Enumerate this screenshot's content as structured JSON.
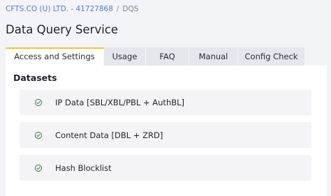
{
  "breadcrumb": {
    "org": "CFTS.CO (U) LTD. - 41727868",
    "separator": "/",
    "current": "DQS"
  },
  "page": {
    "title": "Data Query Service"
  },
  "tabs": [
    {
      "label": "Access and Settings",
      "active": true
    },
    {
      "label": "Usage",
      "active": false
    },
    {
      "label": "FAQ",
      "active": false
    },
    {
      "label": "Manual",
      "active": false
    },
    {
      "label": "Config Check",
      "active": false
    }
  ],
  "datasets": {
    "title": "Datasets",
    "items": [
      {
        "label": "IP Data [SBL/XBL/PBL + AuthBL]",
        "icon": "check-circle-icon"
      },
      {
        "label": "Content Data [DBL + ZRD]",
        "icon": "check-circle-icon"
      },
      {
        "label": "Hash Blocklist",
        "icon": "check-circle-icon"
      }
    ]
  },
  "colors": {
    "active_tab_accent": "#f0c53a",
    "check_icon": "#4a8a5a",
    "link": "#5a78d6"
  }
}
